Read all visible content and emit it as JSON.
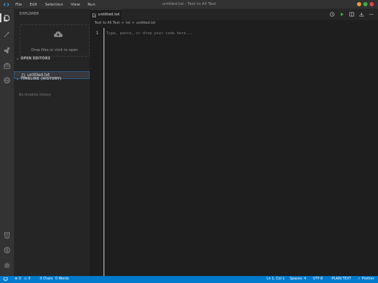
{
  "window": {
    "title": "untitled.txt - Text to All Text",
    "traffic_colors": [
      "#e0a030",
      "#3cb043",
      "#e0443e"
    ]
  },
  "menu": [
    "File",
    "Edit",
    "Selection",
    "View",
    "Run"
  ],
  "activity_bar": {
    "top_icons": [
      "files-icon",
      "magic-wand-icon",
      "extensions-icon",
      "briefcase-icon",
      "globe-icon"
    ],
    "bottom_icons": [
      "html5-icon",
      "account-icon",
      "settings-icon"
    ]
  },
  "sidebar": {
    "title": "EXPLORER",
    "dropzone_text": "Drop files or click to open",
    "open_editors_label": "OPEN EDITORS",
    "open_editors": [
      {
        "label": "untitled.txt"
      }
    ],
    "timeline_label": "TIMELINE (HISTORY)",
    "timeline_empty": "No timeline history."
  },
  "editor": {
    "tab_label": "untitled.txt",
    "breadcrumb": [
      "Text to All Text",
      ">",
      "txt",
      ">",
      "untitled.txt"
    ],
    "line_number": "1",
    "placeholder": "Type, paste, or drop your code here..."
  },
  "statusbar": {
    "errors": "0",
    "warnings": "0",
    "chars": "0 Chars",
    "words": "0 Words",
    "position": "Ln 1, Col 1",
    "spaces": "Spaces: 4",
    "encoding": "UTF-8",
    "language": "PLAIN TEXT",
    "formatter": "Prettier",
    "accent": "#007acc"
  }
}
